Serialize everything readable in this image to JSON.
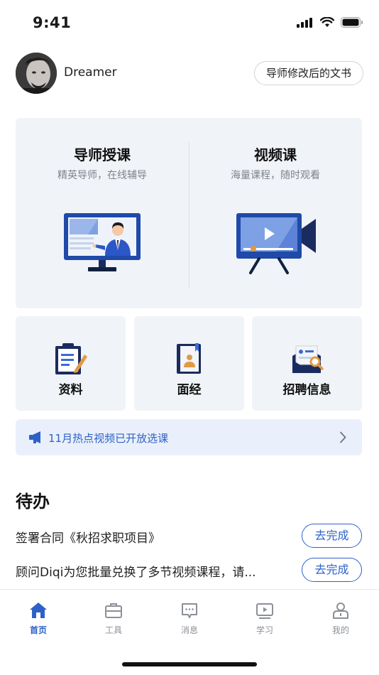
{
  "status_bar": {
    "time": "9:41"
  },
  "header": {
    "username": "Dreamer",
    "doc_button_label": "导师修改后的文书"
  },
  "big_card": {
    "left": {
      "title": "导师授课",
      "subtitle": "精英导师，在线辅导"
    },
    "right": {
      "title": "视频课",
      "subtitle": "海量课程，随时观看"
    }
  },
  "small_cards": [
    {
      "label": "资料",
      "icon": "clipboard-icon"
    },
    {
      "label": "面经",
      "icon": "notebook-icon"
    },
    {
      "label": "招聘信息",
      "icon": "job-search-icon"
    }
  ],
  "banner": {
    "text": "11月热点视频已开放选课",
    "icon": "megaphone-icon"
  },
  "todo": {
    "title": "待办",
    "items": [
      {
        "text": "签署合同《秋招求职项目》",
        "button": "去完成"
      },
      {
        "text": "顾问Diqi为您批量兑换了多节视频课程，请...",
        "button": "去完成"
      }
    ]
  },
  "tab_bar": {
    "active_color": "#2e61c7",
    "tabs": [
      {
        "label": "首页",
        "icon": "home-icon",
        "active": true
      },
      {
        "label": "工具",
        "icon": "toolbox-icon",
        "active": false
      },
      {
        "label": "消息",
        "icon": "message-icon",
        "active": false
      },
      {
        "label": "学习",
        "icon": "video-play-icon",
        "active": false
      },
      {
        "label": "我的",
        "icon": "profile-icon",
        "active": false
      }
    ]
  }
}
